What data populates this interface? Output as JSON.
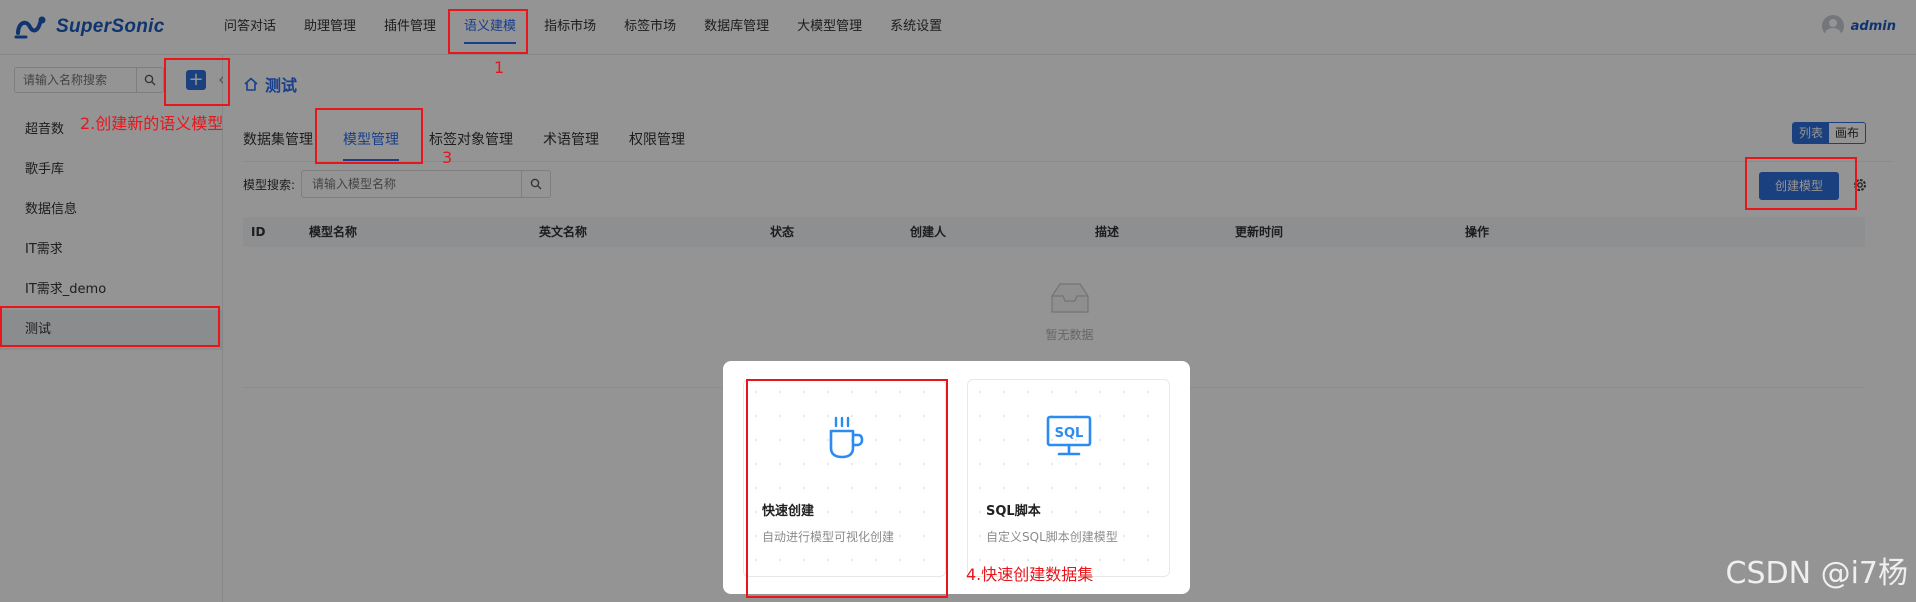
{
  "header": {
    "logo_text": "SuperSonic",
    "nav": [
      "问答对话",
      "助理管理",
      "插件管理",
      "语义建模",
      "指标市场",
      "标签市场",
      "数据库管理",
      "大模型管理",
      "系统设置"
    ],
    "active_nav_index": 3,
    "user": "admin"
  },
  "sidebar": {
    "search_placeholder": "请输入名称搜索",
    "items": [
      "超音数",
      "歌手库",
      "数据信息",
      "IT需求",
      "IT需求_demo",
      "测试"
    ],
    "active_index": 5
  },
  "main": {
    "breadcrumb": "测试",
    "tabs": [
      "数据集管理",
      "模型管理",
      "标签对象管理",
      "术语管理",
      "权限管理"
    ],
    "active_tab_index": 1,
    "view_toggle": {
      "list": "列表",
      "canvas": "画布"
    },
    "filter": {
      "label": "模型搜索:",
      "placeholder": "请输入模型名称"
    },
    "create_button": "创建模型",
    "table": {
      "columns": [
        "ID",
        "模型名称",
        "英文名称",
        "状态",
        "创建人",
        "描述",
        "更新时间",
        "操作"
      ],
      "empty_text": "暂无数据"
    }
  },
  "modal": {
    "cards": [
      {
        "title": "快速创建",
        "desc": "自动进行模型可视化创建",
        "icon": "coffee-cup-icon"
      },
      {
        "title": "SQL脚本",
        "desc": "自定义SQL脚本创建模型",
        "icon": "sql-monitor-icon",
        "icon_text": "SQL"
      }
    ]
  },
  "annotations": {
    "label1": "1",
    "label2": "2.创建新的语义模型",
    "label3": "3",
    "label4": "4.快速创建数据集"
  },
  "watermark": "CSDN @i7杨",
  "colors": {
    "primary": "#2f6fdd",
    "active_text": "#296df3",
    "annotation": "#e8151b",
    "logo": "#1a5bbd"
  }
}
